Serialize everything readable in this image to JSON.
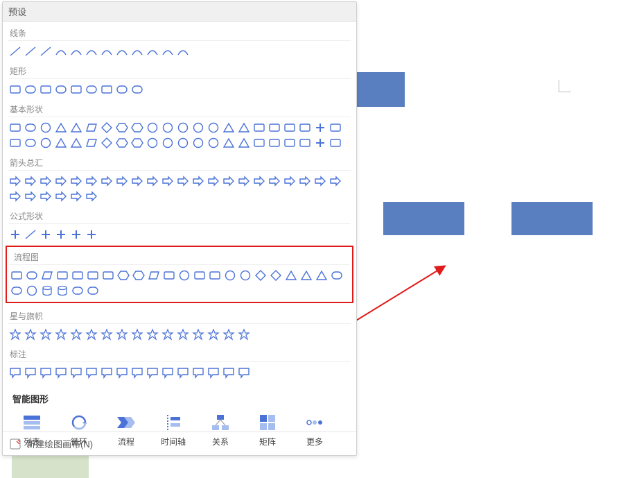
{
  "panel": {
    "header": "预设",
    "categories": [
      {
        "key": "lines",
        "label": "线条",
        "count": 12
      },
      {
        "key": "rects",
        "label": "矩形",
        "count": 9
      },
      {
        "key": "basic",
        "label": "基本形状",
        "count": 44
      },
      {
        "key": "arrows",
        "label": "箭头总汇",
        "count": 28
      },
      {
        "key": "equation",
        "label": "公式形状",
        "count": 6
      },
      {
        "key": "flow",
        "label": "流程图",
        "count": 28
      },
      {
        "key": "stars",
        "label": "星与旗帜",
        "count": 16
      },
      {
        "key": "callouts",
        "label": "标注",
        "count": 16
      }
    ],
    "smart": {
      "title": "智能图形",
      "items": [
        {
          "key": "list",
          "label": "列表"
        },
        {
          "key": "cycle",
          "label": "循环"
        },
        {
          "key": "process",
          "label": "流程"
        },
        {
          "key": "timeline",
          "label": "时间轴"
        },
        {
          "key": "relation",
          "label": "关系"
        },
        {
          "key": "matrix",
          "label": "矩阵"
        },
        {
          "key": "more",
          "label": "更多"
        }
      ]
    },
    "footer": {
      "label": "新建绘图画布(N)"
    }
  },
  "canvas": {
    "shapes": [
      {
        "name": "rect-a",
        "type": "rect",
        "fill": "#5a7fc0"
      },
      {
        "name": "tri-a",
        "type": "triangle",
        "fill": "#5a7fc0"
      },
      {
        "name": "rect-b",
        "type": "rect",
        "fill": "#5a7fc0"
      },
      {
        "name": "rect-c",
        "type": "rect",
        "fill": "#5a7fc0"
      }
    ],
    "annotation_arrow_color": "#e11a1a"
  }
}
